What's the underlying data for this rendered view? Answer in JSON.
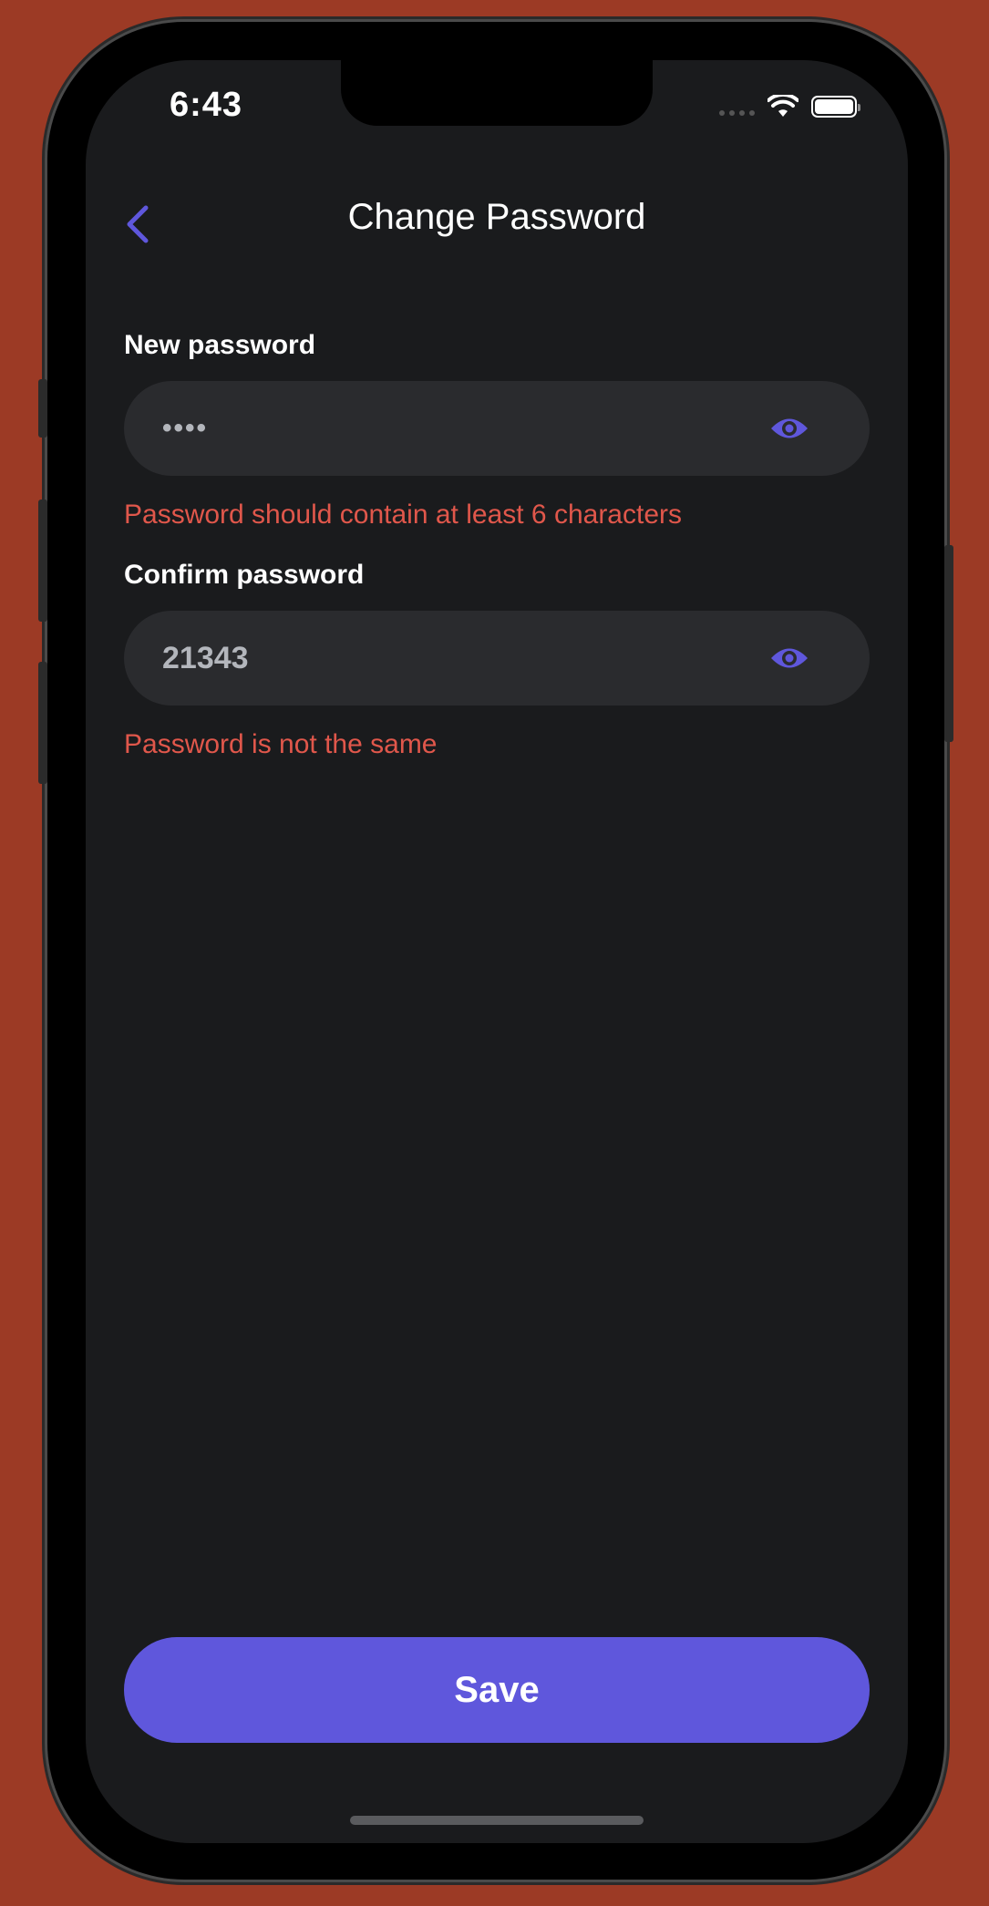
{
  "status_bar": {
    "time": "6:43",
    "wifi_icon": "wifi-icon",
    "battery_icon": "battery-icon"
  },
  "header": {
    "title": "Change Password",
    "back_icon": "chevron-left-icon"
  },
  "form": {
    "new_password": {
      "label": "New password",
      "value": "••••",
      "toggle_icon": "eye-icon",
      "error": "Password should contain at least 6 characters"
    },
    "confirm_password": {
      "label": "Confirm password",
      "value": "21343",
      "toggle_icon": "eye-icon",
      "error": "Password is not the same"
    }
  },
  "actions": {
    "save_label": "Save"
  },
  "colors": {
    "accent": "#5f57dc",
    "error": "#e0574b",
    "background": "#1a1b1d",
    "field_background": "#2a2b2e",
    "outer_background": "#9c3a25"
  }
}
